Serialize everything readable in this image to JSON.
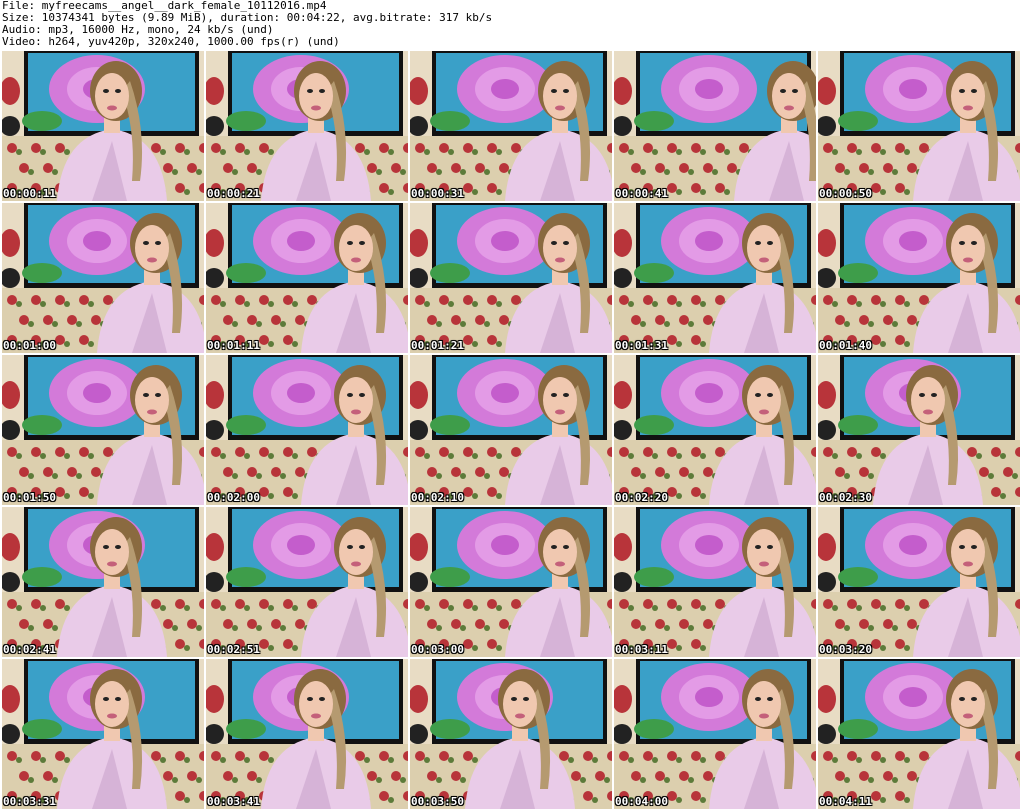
{
  "header": {
    "file": "File: myfreecams__angel__dark_female_10112016.mp4",
    "size": "Size: 10374341 bytes (9.89 MiB), duration: 00:04:22, avg.bitrate: 317 kb/s",
    "audio": "Audio: mp3, 16000 Hz, mono, 24 kb/s (und)",
    "video": "Video: h264, yuv420p, 320x240, 1000.00 fps(r) (und)"
  },
  "colors": {
    "robe": "#e9cbe8",
    "robe_shadow": "#c9a3cc",
    "screen_bg": "#3aa0c8",
    "rose": "#d37ad9",
    "wall": "#e8dcc4",
    "skin": "#f0c8b0",
    "hair": "#8a6a40"
  },
  "thumbnails": [
    {
      "time": "00:00:11",
      "pose": "center"
    },
    {
      "time": "00:00:21",
      "pose": "center"
    },
    {
      "time": "00:00:31",
      "pose": "right"
    },
    {
      "time": "00:00:41",
      "pose": "right-edge"
    },
    {
      "time": "00:00:50",
      "pose": "right"
    },
    {
      "time": "00:01:00",
      "pose": "right"
    },
    {
      "time": "00:01:11",
      "pose": "right"
    },
    {
      "time": "00:01:21",
      "pose": "right"
    },
    {
      "time": "00:01:31",
      "pose": "right"
    },
    {
      "time": "00:01:40",
      "pose": "right"
    },
    {
      "time": "00:01:50",
      "pose": "right"
    },
    {
      "time": "00:02:00",
      "pose": "right"
    },
    {
      "time": "00:02:10",
      "pose": "right"
    },
    {
      "time": "00:02:20",
      "pose": "right"
    },
    {
      "time": "00:02:30",
      "pose": "center"
    },
    {
      "time": "00:02:41",
      "pose": "center"
    },
    {
      "time": "00:02:51",
      "pose": "right"
    },
    {
      "time": "00:03:00",
      "pose": "right"
    },
    {
      "time": "00:03:11",
      "pose": "right"
    },
    {
      "time": "00:03:20",
      "pose": "right"
    },
    {
      "time": "00:03:31",
      "pose": "center"
    },
    {
      "time": "00:03:41",
      "pose": "center"
    },
    {
      "time": "00:03:50",
      "pose": "center"
    },
    {
      "time": "00:04:00",
      "pose": "right"
    },
    {
      "time": "00:04:11",
      "pose": "right"
    }
  ]
}
